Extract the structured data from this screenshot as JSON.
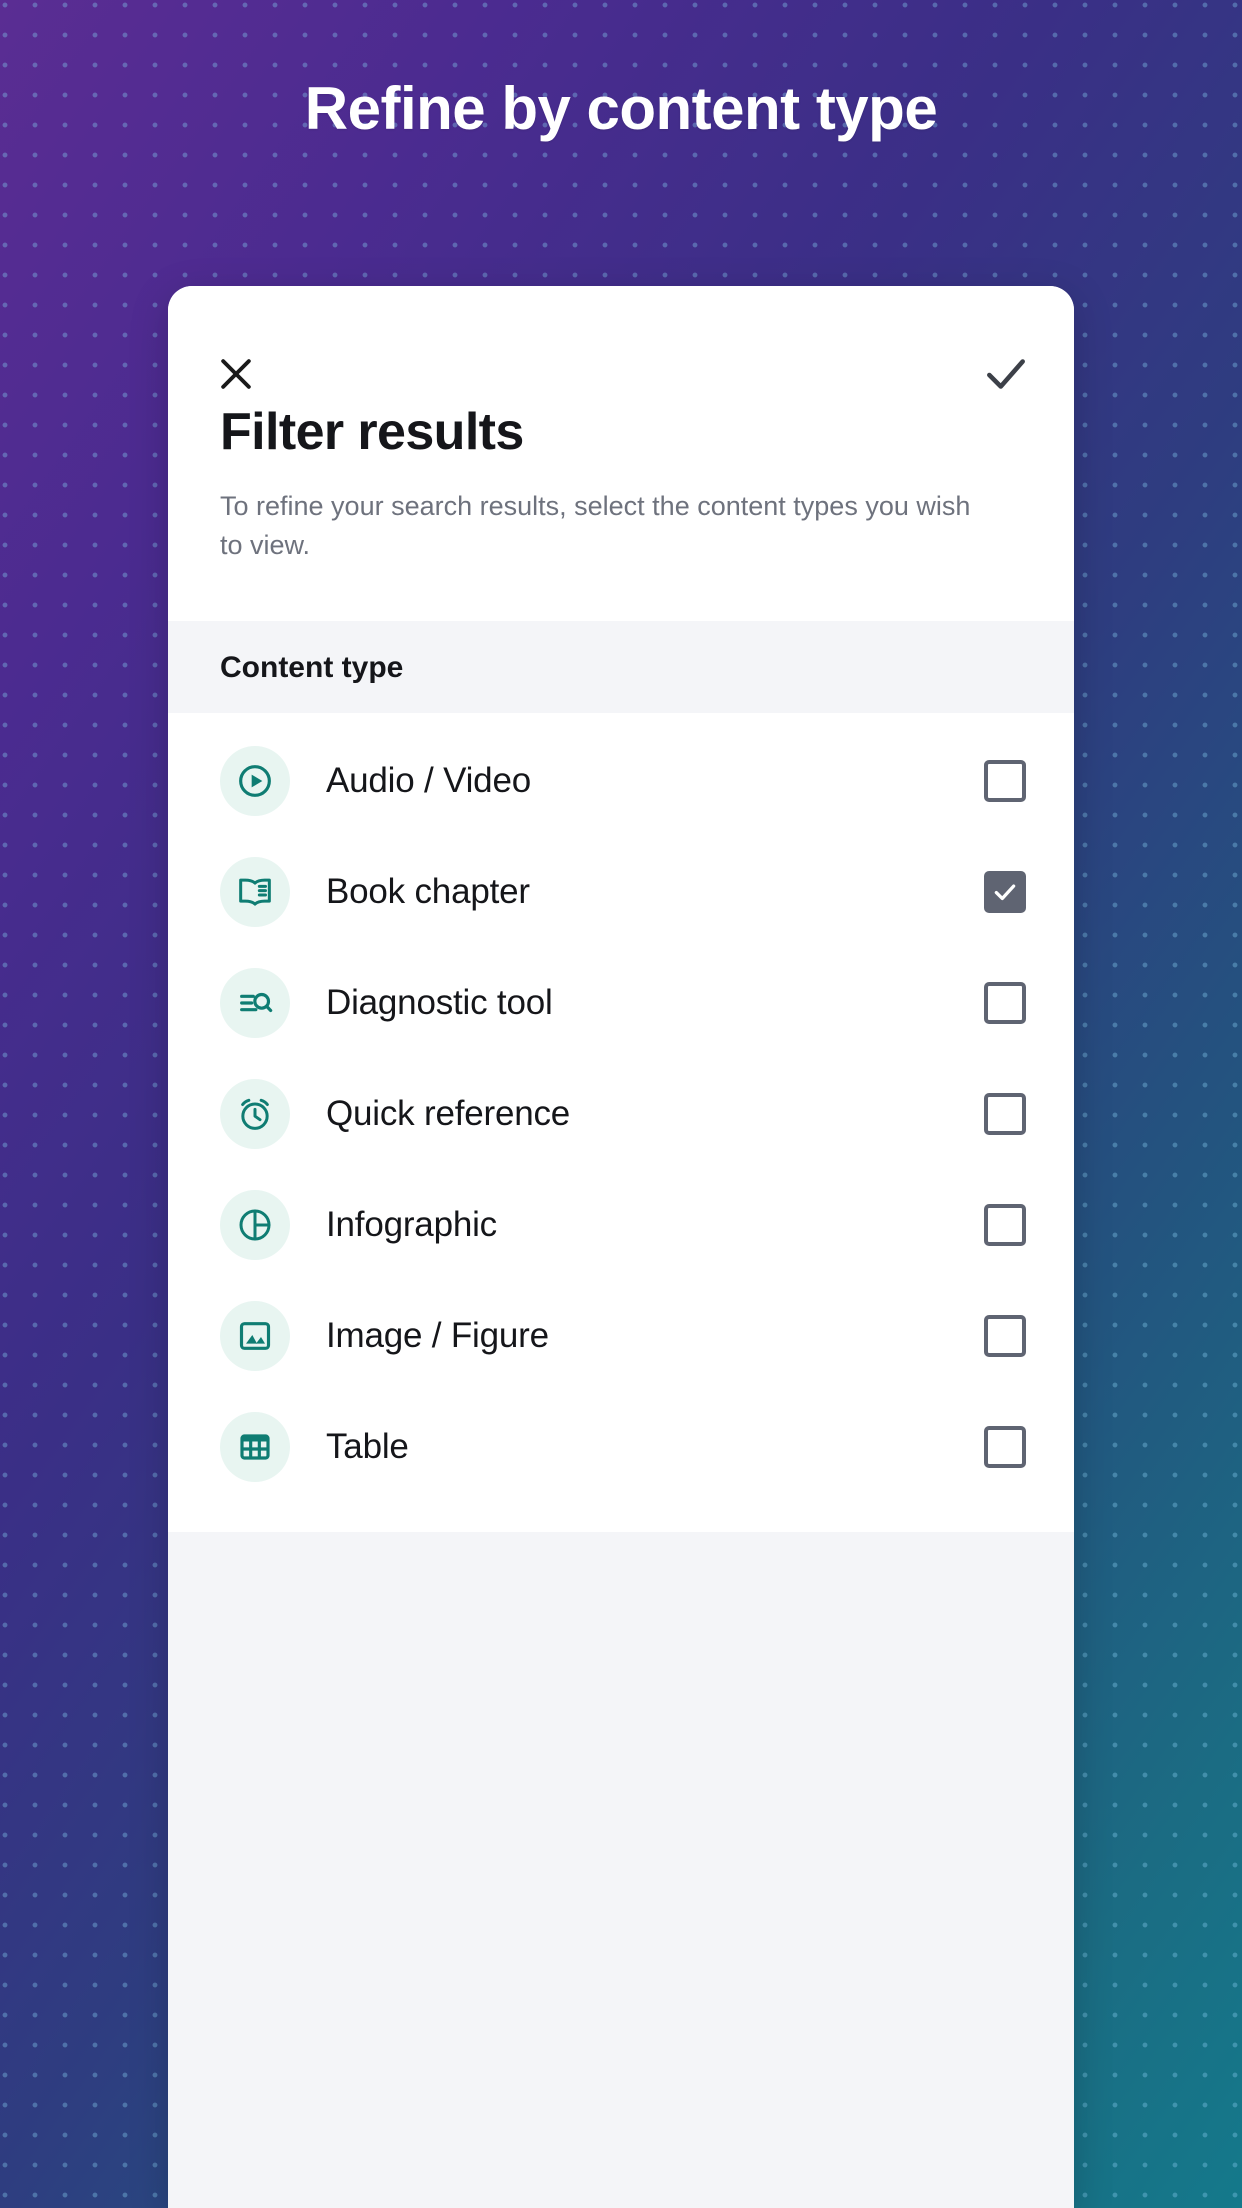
{
  "page": {
    "title": "Refine by content type",
    "background": {
      "gradient_from": "#5a2d93",
      "gradient_to": "#14798b",
      "dot_color": "#82c8eb"
    }
  },
  "dialog": {
    "close_icon": "close-x-icon",
    "confirm_icon": "check-icon",
    "title": "Filter results",
    "description": "To refine your search results, select the content types you wish to view.",
    "section_header": "Content type",
    "accent_color": "#0f7d73",
    "icon_bg_color": "#e8f5f1",
    "checkbox_color": "#5f6472",
    "card_bg": "#ffffff",
    "section_bg": "#f4f5f8"
  },
  "content_types": [
    {
      "label": "Audio / Video",
      "icon": "play-circle-icon",
      "checked": false
    },
    {
      "label": "Book chapter",
      "icon": "open-book-icon",
      "checked": true
    },
    {
      "label": "Diagnostic tool",
      "icon": "list-search-icon",
      "checked": false
    },
    {
      "label": "Quick reference",
      "icon": "alarm-clock-icon",
      "checked": false
    },
    {
      "label": "Infographic",
      "icon": "pie-chart-icon",
      "checked": false
    },
    {
      "label": "Image / Figure",
      "icon": "image-picture-icon",
      "checked": false
    },
    {
      "label": "Table",
      "icon": "table-grid-icon",
      "checked": false
    }
  ]
}
